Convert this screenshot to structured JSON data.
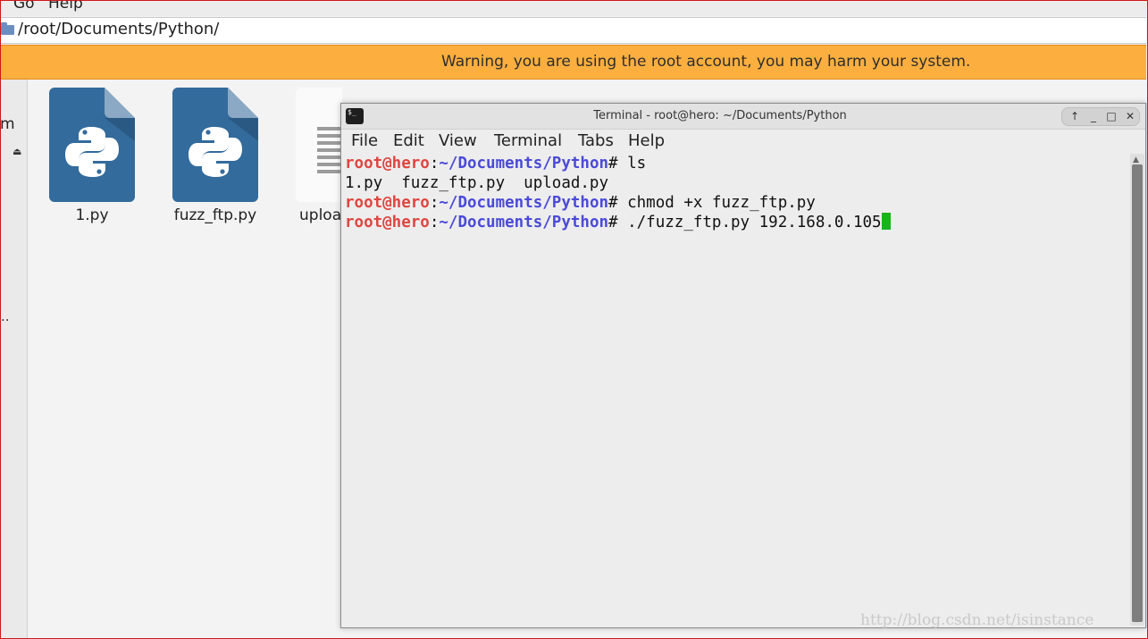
{
  "file_manager": {
    "menu": [
      "Go",
      "Help"
    ],
    "location_path": "/root/Documents/Python/",
    "warning": "Warning, you are using the root account, you may harm your system.",
    "sidebar": {
      "partial_label": "m",
      "eject_glyph": "⏏",
      "ellipsis": ".."
    },
    "files": [
      {
        "name": "1.py",
        "icon": "python-file-icon"
      },
      {
        "name": "fuzz_ftp.py",
        "icon": "python-file-icon"
      },
      {
        "name": "upload.py",
        "icon": "text-file-icon"
      }
    ],
    "partial_file_label": "uploa",
    "colors": {
      "warning_bg": "#fcaf3e",
      "python_icon": "#336b9c",
      "python_fold": "#8ba9c4"
    }
  },
  "terminal": {
    "title": "Terminal - root@hero: ~/Documents/Python",
    "icon_text": "$_",
    "window_controls": [
      "↑",
      "_",
      "□",
      "✕"
    ],
    "menu": [
      "File",
      "Edit",
      "View",
      "Terminal",
      "Tabs",
      "Help"
    ],
    "prompt": {
      "user": "root@hero",
      "colon": ":",
      "path": "~/Documents/Python",
      "symbol": "#"
    },
    "lines": [
      {
        "type": "prompt",
        "command": " ls"
      },
      {
        "type": "output",
        "text": "1.py  fuzz_ftp.py  upload.py"
      },
      {
        "type": "prompt",
        "command": " chmod +x fuzz_ftp.py"
      },
      {
        "type": "prompt",
        "command": " ./fuzz_ftp.py 192.168.0.105"
      }
    ],
    "colors": {
      "user": "#e0453f",
      "path": "#4a4ad8",
      "cursor": "#18b418"
    }
  },
  "watermark": "http://blog.csdn.net/isinstance"
}
